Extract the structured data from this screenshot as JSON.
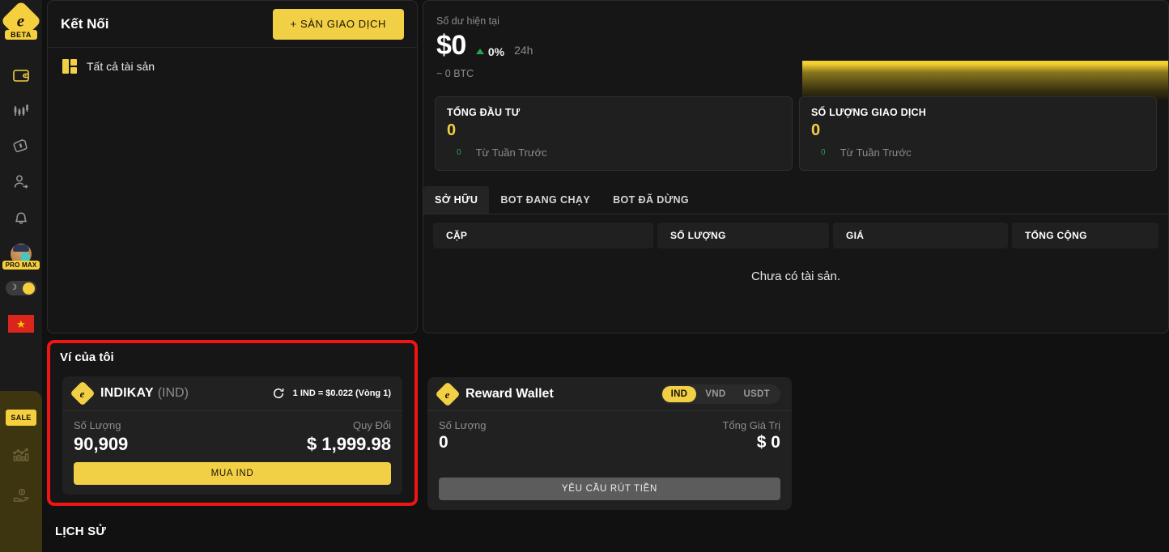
{
  "sidebar": {
    "logo": {
      "name": "logo-diamond",
      "glyph": "e",
      "badge": "BETA"
    },
    "nav": [
      {
        "icon": "wallet-icon",
        "active": true
      },
      {
        "icon": "candlestick-chart-icon",
        "active": false
      },
      {
        "icon": "price-tag-icon",
        "active": false
      },
      {
        "icon": "user-share-icon",
        "active": false
      },
      {
        "icon": "bell-icon",
        "active": false
      }
    ],
    "profile": {
      "badge": "PRO MAX"
    },
    "theme_toggle": {
      "moon": "☽",
      "state": "on"
    },
    "language_flag": {
      "star": "★"
    },
    "sale_panel": {
      "badge": "SALE",
      "items": [
        {
          "icon": "analytics-chart-icon"
        },
        {
          "icon": "hand-money-icon"
        }
      ]
    }
  },
  "connect": {
    "title": "Kết Nối",
    "exchange_button": "+ SÀN GIAO DỊCH",
    "all_assets": "Tất cả tài sản"
  },
  "balance": {
    "label": "Số dư hiện tại",
    "amount": "$0",
    "change_pct": "0%",
    "period": "24h",
    "btc_approx": "~ 0 BTC",
    "stats": [
      {
        "title": "TỔNG ĐẦU TƯ",
        "value": "0",
        "sub_num": "0",
        "sub_text": "Từ Tuần Trước"
      },
      {
        "title": "SỐ LƯỢNG GIAO DỊCH",
        "value": "0",
        "sub_num": "0",
        "sub_text": "Từ Tuần Trước"
      }
    ]
  },
  "portfolio": {
    "tabs": [
      {
        "label": "SỞ HỮU",
        "active": true
      },
      {
        "label": "BOT ĐANG CHẠY",
        "active": false
      },
      {
        "label": "BOT ĐÃ DỪNG",
        "active": false
      }
    ],
    "columns": [
      "CẶP",
      "SỐ LƯỢNG",
      "GIÁ",
      "TỔNG CỘNG"
    ],
    "empty_message": "Chưa có tài sản."
  },
  "wallet": {
    "title": "Ví của tôi",
    "coin": {
      "mark_glyph": "e",
      "name": "INDIKAY",
      "ticker": "(IND)",
      "refresh_icon": "refresh-icon",
      "rate": "1 IND = $0.022 (Vòng 1)",
      "qty_label": "Số Lượng",
      "qty_value": "90,909",
      "convert_label": "Quy Đổi",
      "convert_value": "$ 1,999.98",
      "buy_button": "MUA IND"
    }
  },
  "reward_wallet": {
    "mark_glyph": "e",
    "name": "Reward Wallet",
    "currencies": [
      {
        "label": "IND",
        "selected": true
      },
      {
        "label": "VND",
        "selected": false
      },
      {
        "label": "USDT",
        "selected": false
      }
    ],
    "qty_label": "Số Lượng",
    "qty_value": "0",
    "total_label": "Tổng Giá Trị",
    "total_value": "$ 0",
    "withdraw_button": "YÊU CẦU RÚT TIỀN"
  },
  "history": {
    "title": "LỊCH SỬ"
  },
  "colors": {
    "accent": "#f2d045",
    "positive": "#2f9e55",
    "highlight": "#f01414",
    "bg": "#111111",
    "card": "#161616"
  }
}
